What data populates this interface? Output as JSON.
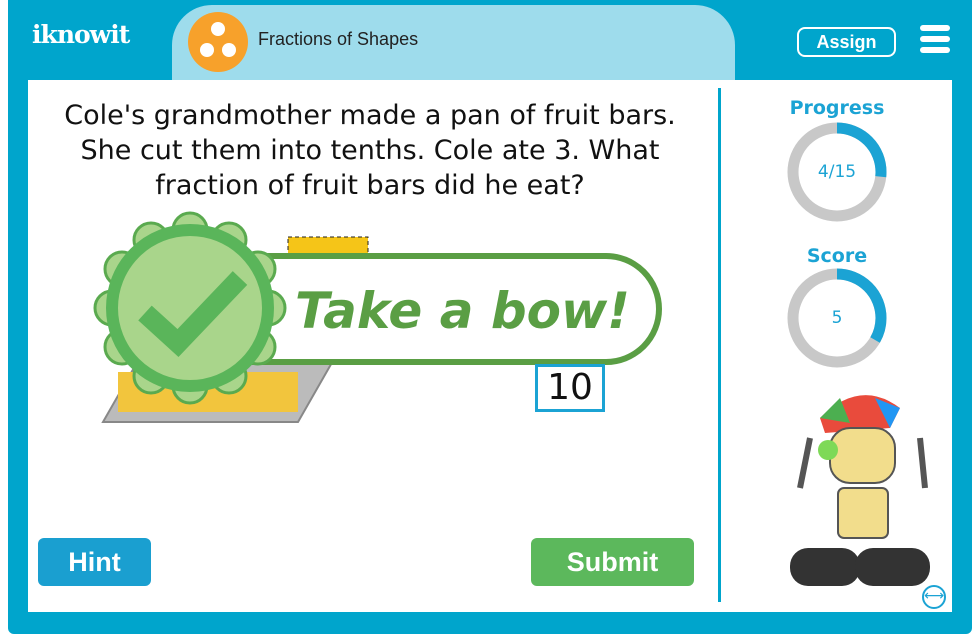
{
  "header": {
    "logo": "iknowit",
    "topic": "Fractions of Shapes",
    "assign_label": "Assign"
  },
  "question": {
    "text": "Cole's grandmother made a pan of fruit bars. She cut them into tenths. Cole ate 3. What fraction of fruit bars did he eat?",
    "denominator": "10"
  },
  "feedback": {
    "message": "Take a bow!"
  },
  "progress": {
    "label": "Progress",
    "value": "4/15",
    "fraction": 0.2667
  },
  "score": {
    "label": "Score",
    "value": "5",
    "fraction": 0.333
  },
  "buttons": {
    "hint": "Hint",
    "submit": "Submit"
  },
  "colors": {
    "brand": "#00a5cc",
    "tab": "#9edcec",
    "accent": "#1ba3d4",
    "success": "#5cb85c",
    "feedback": "#5a9e44",
    "topic_icon": "#f7a12b"
  }
}
